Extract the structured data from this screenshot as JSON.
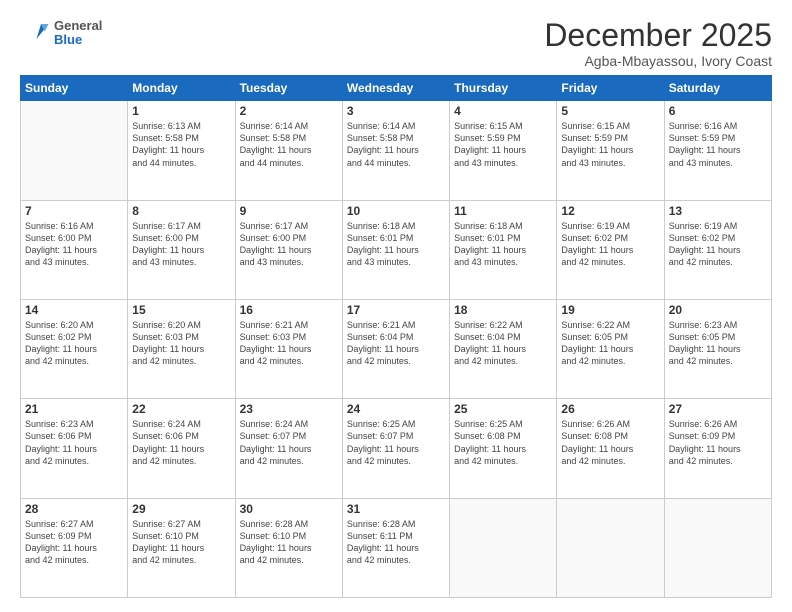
{
  "logo": {
    "general": "General",
    "blue": "Blue"
  },
  "header": {
    "title": "December 2025",
    "subtitle": "Agba-Mbayassou, Ivory Coast"
  },
  "days_of_week": [
    "Sunday",
    "Monday",
    "Tuesday",
    "Wednesday",
    "Thursday",
    "Friday",
    "Saturday"
  ],
  "weeks": [
    [
      {
        "day": "",
        "info": ""
      },
      {
        "day": "1",
        "info": "Sunrise: 6:13 AM\nSunset: 5:58 PM\nDaylight: 11 hours\nand 44 minutes."
      },
      {
        "day": "2",
        "info": "Sunrise: 6:14 AM\nSunset: 5:58 PM\nDaylight: 11 hours\nand 44 minutes."
      },
      {
        "day": "3",
        "info": "Sunrise: 6:14 AM\nSunset: 5:58 PM\nDaylight: 11 hours\nand 44 minutes."
      },
      {
        "day": "4",
        "info": "Sunrise: 6:15 AM\nSunset: 5:59 PM\nDaylight: 11 hours\nand 43 minutes."
      },
      {
        "day": "5",
        "info": "Sunrise: 6:15 AM\nSunset: 5:59 PM\nDaylight: 11 hours\nand 43 minutes."
      },
      {
        "day": "6",
        "info": "Sunrise: 6:16 AM\nSunset: 5:59 PM\nDaylight: 11 hours\nand 43 minutes."
      }
    ],
    [
      {
        "day": "7",
        "info": "Sunrise: 6:16 AM\nSunset: 6:00 PM\nDaylight: 11 hours\nand 43 minutes."
      },
      {
        "day": "8",
        "info": "Sunrise: 6:17 AM\nSunset: 6:00 PM\nDaylight: 11 hours\nand 43 minutes."
      },
      {
        "day": "9",
        "info": "Sunrise: 6:17 AM\nSunset: 6:00 PM\nDaylight: 11 hours\nand 43 minutes."
      },
      {
        "day": "10",
        "info": "Sunrise: 6:18 AM\nSunset: 6:01 PM\nDaylight: 11 hours\nand 43 minutes."
      },
      {
        "day": "11",
        "info": "Sunrise: 6:18 AM\nSunset: 6:01 PM\nDaylight: 11 hours\nand 43 minutes."
      },
      {
        "day": "12",
        "info": "Sunrise: 6:19 AM\nSunset: 6:02 PM\nDaylight: 11 hours\nand 42 minutes."
      },
      {
        "day": "13",
        "info": "Sunrise: 6:19 AM\nSunset: 6:02 PM\nDaylight: 11 hours\nand 42 minutes."
      }
    ],
    [
      {
        "day": "14",
        "info": "Sunrise: 6:20 AM\nSunset: 6:02 PM\nDaylight: 11 hours\nand 42 minutes."
      },
      {
        "day": "15",
        "info": "Sunrise: 6:20 AM\nSunset: 6:03 PM\nDaylight: 11 hours\nand 42 minutes."
      },
      {
        "day": "16",
        "info": "Sunrise: 6:21 AM\nSunset: 6:03 PM\nDaylight: 11 hours\nand 42 minutes."
      },
      {
        "day": "17",
        "info": "Sunrise: 6:21 AM\nSunset: 6:04 PM\nDaylight: 11 hours\nand 42 minutes."
      },
      {
        "day": "18",
        "info": "Sunrise: 6:22 AM\nSunset: 6:04 PM\nDaylight: 11 hours\nand 42 minutes."
      },
      {
        "day": "19",
        "info": "Sunrise: 6:22 AM\nSunset: 6:05 PM\nDaylight: 11 hours\nand 42 minutes."
      },
      {
        "day": "20",
        "info": "Sunrise: 6:23 AM\nSunset: 6:05 PM\nDaylight: 11 hours\nand 42 minutes."
      }
    ],
    [
      {
        "day": "21",
        "info": "Sunrise: 6:23 AM\nSunset: 6:06 PM\nDaylight: 11 hours\nand 42 minutes."
      },
      {
        "day": "22",
        "info": "Sunrise: 6:24 AM\nSunset: 6:06 PM\nDaylight: 11 hours\nand 42 minutes."
      },
      {
        "day": "23",
        "info": "Sunrise: 6:24 AM\nSunset: 6:07 PM\nDaylight: 11 hours\nand 42 minutes."
      },
      {
        "day": "24",
        "info": "Sunrise: 6:25 AM\nSunset: 6:07 PM\nDaylight: 11 hours\nand 42 minutes."
      },
      {
        "day": "25",
        "info": "Sunrise: 6:25 AM\nSunset: 6:08 PM\nDaylight: 11 hours\nand 42 minutes."
      },
      {
        "day": "26",
        "info": "Sunrise: 6:26 AM\nSunset: 6:08 PM\nDaylight: 11 hours\nand 42 minutes."
      },
      {
        "day": "27",
        "info": "Sunrise: 6:26 AM\nSunset: 6:09 PM\nDaylight: 11 hours\nand 42 minutes."
      }
    ],
    [
      {
        "day": "28",
        "info": "Sunrise: 6:27 AM\nSunset: 6:09 PM\nDaylight: 11 hours\nand 42 minutes."
      },
      {
        "day": "29",
        "info": "Sunrise: 6:27 AM\nSunset: 6:10 PM\nDaylight: 11 hours\nand 42 minutes."
      },
      {
        "day": "30",
        "info": "Sunrise: 6:28 AM\nSunset: 6:10 PM\nDaylight: 11 hours\nand 42 minutes."
      },
      {
        "day": "31",
        "info": "Sunrise: 6:28 AM\nSunset: 6:11 PM\nDaylight: 11 hours\nand 42 minutes."
      },
      {
        "day": "",
        "info": ""
      },
      {
        "day": "",
        "info": ""
      },
      {
        "day": "",
        "info": ""
      }
    ]
  ]
}
